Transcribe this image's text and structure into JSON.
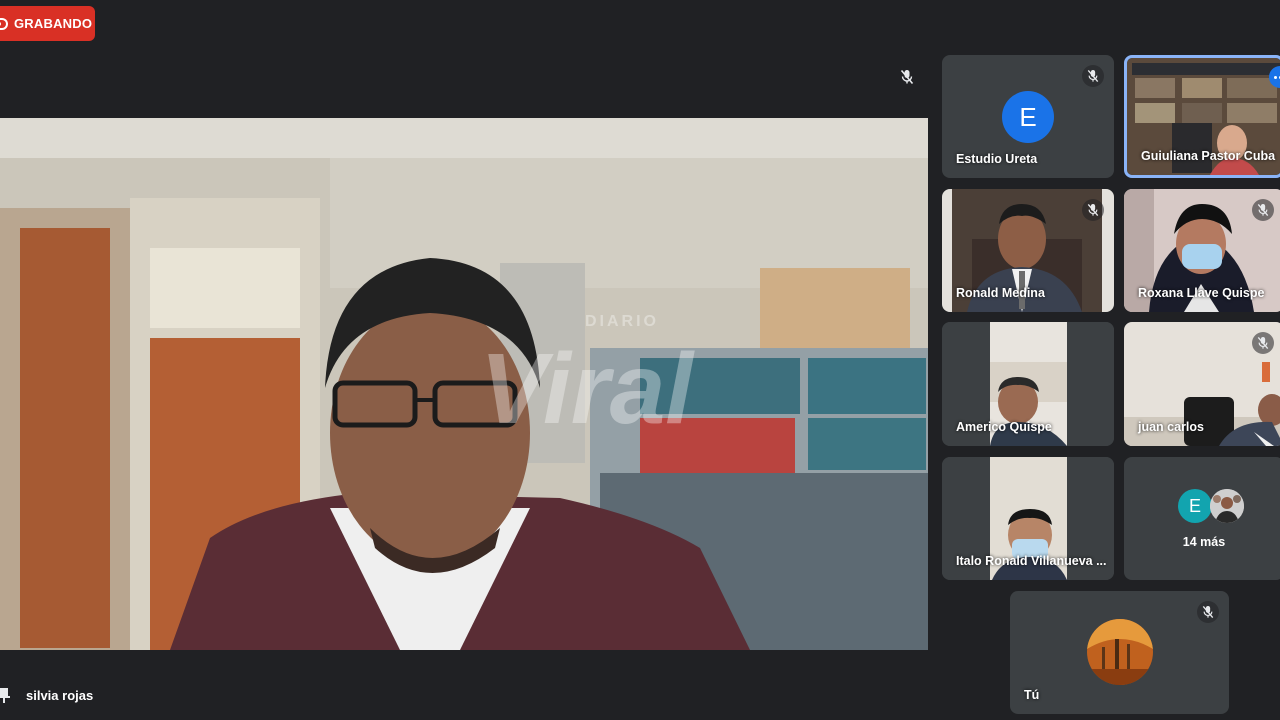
{
  "recording": {
    "label": "GRABANDO"
  },
  "main": {
    "speaker_name": "silvia rojas"
  },
  "tiles": [
    {
      "name": "Estudio Ureta",
      "avatar_letter": "E"
    },
    {
      "name": "Guiuliana Pastor Cuba"
    },
    {
      "name": "Ronald Medina"
    },
    {
      "name": "Roxana Llave Quispe"
    },
    {
      "name": "Americo Quispe"
    },
    {
      "name": "juan carlos"
    },
    {
      "name": "Italo Ronald Villanueva ..."
    },
    {
      "more_label": "14 más",
      "avatar_letter": "E"
    },
    {
      "name": "Tú"
    }
  ],
  "watermark": {
    "brand": "DIARIO",
    "text": "Viral"
  },
  "colors": {
    "background": "#202124",
    "tile": "#3c4043",
    "recording": "#d93025",
    "accent": "#1a73e8",
    "active_border": "#8ab4f8"
  },
  "icons": {
    "recording": "record-icon",
    "mic": "mic-off-icon",
    "pin": "pin-icon",
    "more": "more-options-icon"
  }
}
